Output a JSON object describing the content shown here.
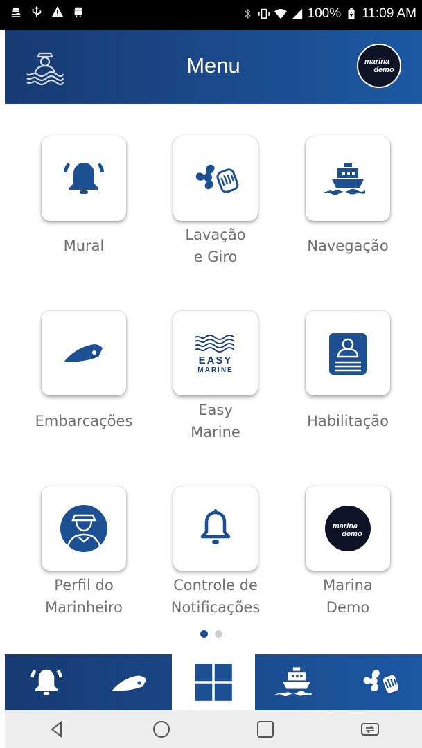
{
  "status_bar": {
    "battery": "100%",
    "time": "11:09 AM",
    "left_icons": [
      "sailor-notification-icon",
      "usb-icon",
      "warning-icon",
      "android-icon"
    ],
    "right_icons": [
      "bluetooth-icon",
      "vibrate-icon",
      "wifi-icon",
      "signal-icon",
      "battery-icon"
    ]
  },
  "header": {
    "title": "Menu",
    "logo_icon": "sailor-waves-icon",
    "profile_brand_top": "marina",
    "profile_brand_bottom": "demo"
  },
  "menu": {
    "items": [
      {
        "line1": "Mural",
        "line2": "",
        "icon": "alarm-bell-icon"
      },
      {
        "line1": "Lavação",
        "line2": "e Giro",
        "icon": "propeller-hand-icon"
      },
      {
        "line1": "Navegação",
        "line2": "",
        "icon": "ship-icon"
      },
      {
        "line1": "Embarcações",
        "line2": "",
        "icon": "speedboat-icon"
      },
      {
        "line1": "Easy",
        "line2": "Marine",
        "icon": "easy-marine-logo-icon",
        "logo_top": "EASY",
        "logo_bottom": "MARINE"
      },
      {
        "line1": "Habilitação",
        "line2": "",
        "icon": "license-card-icon"
      },
      {
        "line1": "Perfil do",
        "line2": "Marinheiro",
        "icon": "sailor-avatar-icon"
      },
      {
        "line1": "Controle de",
        "line2": "Notificações",
        "icon": "bell-icon"
      },
      {
        "line1": "Marina",
        "line2": "Demo",
        "icon": "marina-demo-logo-icon",
        "logo_top": "marina",
        "logo_bottom": "demo"
      }
    ],
    "page_indicator": {
      "pages": 2,
      "current": 1
    }
  },
  "bottom_nav": {
    "items": [
      {
        "icon": "alarm-bell-icon"
      },
      {
        "icon": "speedboat-icon"
      },
      {
        "icon": "grid-icon",
        "active": true
      },
      {
        "icon": "ship-icon"
      },
      {
        "icon": "propeller-hand-icon"
      }
    ]
  },
  "system_nav": {
    "items": [
      "back-icon",
      "home-icon",
      "recents-icon",
      "rotate-icon"
    ]
  },
  "colors": {
    "primary": "#1d4f93",
    "header_start": "#173a72",
    "header_end": "#1d58a3",
    "label_text": "#707070"
  }
}
